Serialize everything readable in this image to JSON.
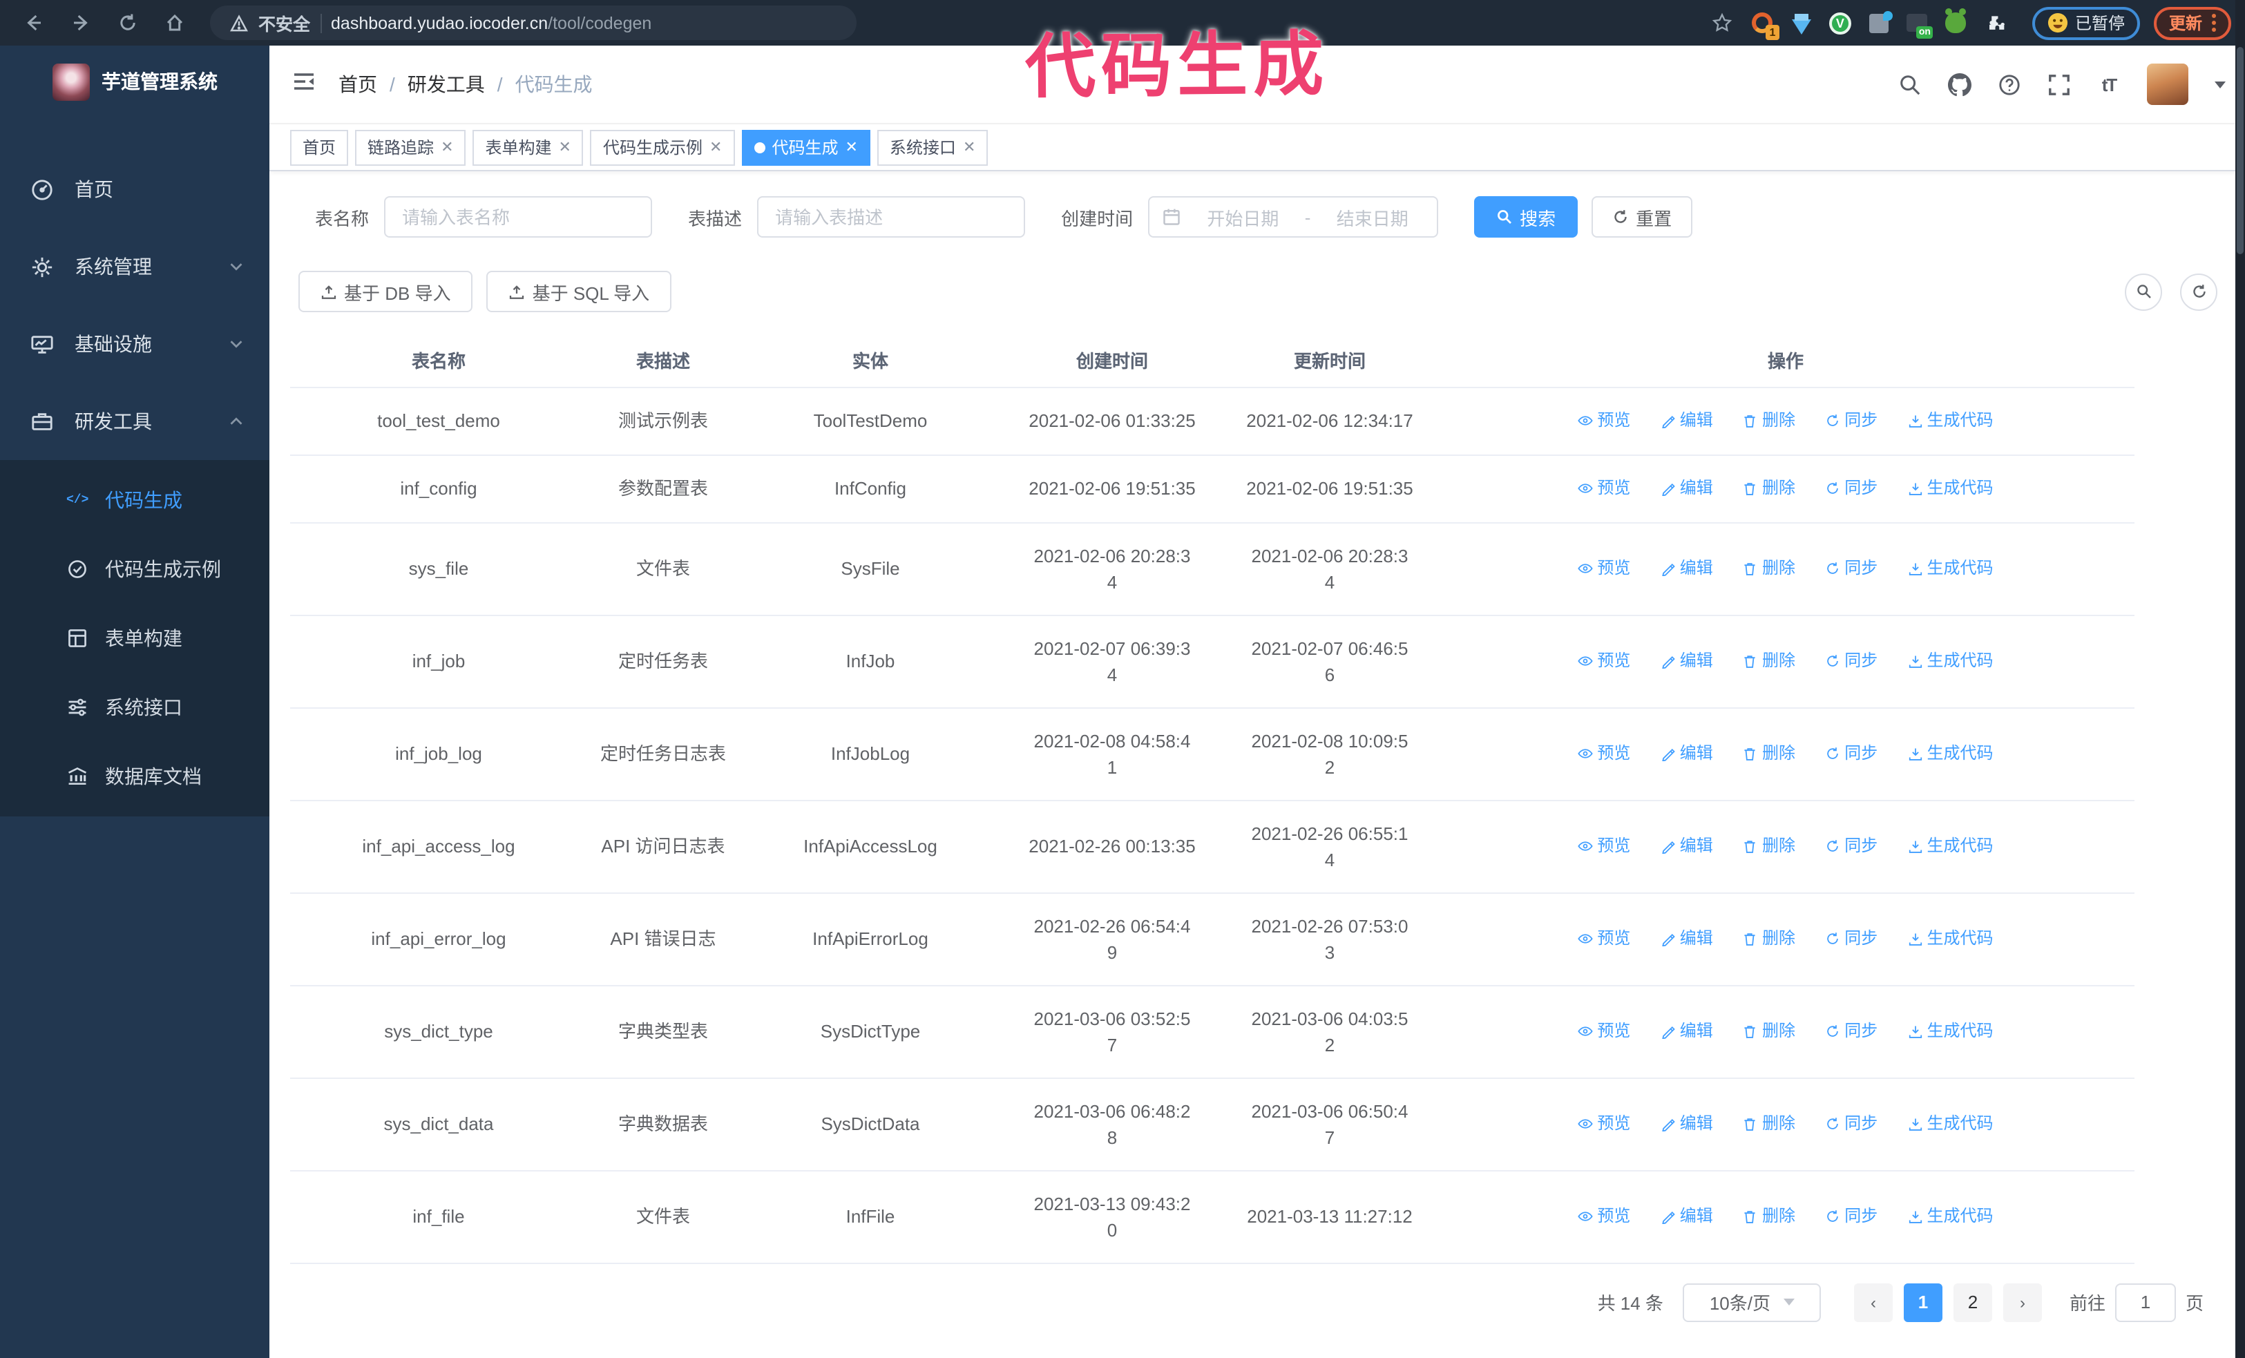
{
  "colors": {
    "accent": "#409eff",
    "annotation": "#ee4070",
    "browser_bar_bg": "#202b38",
    "sidebar_bg": "#223750",
    "sidebar_submenu_bg": "#1b2b3c",
    "paused_border": "#3f8cd6",
    "update_accent": "#e25b3c"
  },
  "annotation": {
    "text": "代码生成"
  },
  "browser": {
    "security_label": "不安全",
    "url_host": "dashboard.yudao.iocoder.cn",
    "url_path": "/tool/codegen",
    "extension_badge": "1",
    "extension_on_badge": "on",
    "paused_badge": "已暂停",
    "update_button": "更新"
  },
  "sidebar": {
    "title": "芋道管理系统",
    "items": [
      {
        "label": "首页"
      },
      {
        "label": "系统管理"
      },
      {
        "label": "基础设施"
      },
      {
        "label": "研发工具"
      }
    ],
    "submenu": [
      {
        "label": "代码生成"
      },
      {
        "label": "代码生成示例"
      },
      {
        "label": "表单构建"
      },
      {
        "label": "系统接口"
      },
      {
        "label": "数据库文档"
      }
    ]
  },
  "navbar": {
    "breadcrumb": [
      "首页",
      "研发工具",
      "代码生成"
    ],
    "separator": "/"
  },
  "tabs": [
    {
      "label": "首页"
    },
    {
      "label": "链路追踪"
    },
    {
      "label": "表单构建"
    },
    {
      "label": "代码生成示例"
    },
    {
      "label": "代码生成"
    },
    {
      "label": "系统接口"
    }
  ],
  "filter": {
    "table_name_label": "表名称",
    "table_name_placeholder": "请输入表名称",
    "table_desc_label": "表描述",
    "table_desc_placeholder": "请输入表描述",
    "create_time_label": "创建时间",
    "date_start_placeholder": "开始日期",
    "date_separator": "-",
    "date_end_placeholder": "结束日期",
    "search_label": "搜索",
    "reset_label": "重置"
  },
  "toolbar": {
    "db_import_label": "基于 DB 导入",
    "sql_import_label": "基于 SQL 导入"
  },
  "table": {
    "columns": [
      "表名称",
      "表描述",
      "实体",
      "创建时间",
      "更新时间",
      "操作"
    ],
    "actions": [
      "预览",
      "编辑",
      "删除",
      "同步",
      "生成代码"
    ],
    "rows": [
      {
        "name": "tool_test_demo",
        "desc": "测试示例表",
        "entity": "ToolTestDemo",
        "created": "2021-02-06 01:33:25",
        "updated": "2021-02-06 12:34:17"
      },
      {
        "name": "inf_config",
        "desc": "参数配置表",
        "entity": "InfConfig",
        "created": "2021-02-06 19:51:35",
        "updated": "2021-02-06 19:51:35"
      },
      {
        "name": "sys_file",
        "desc": "文件表",
        "entity": "SysFile",
        "created": "2021-02-06 20:28:3\n4",
        "updated": "2021-02-06 20:28:3\n4"
      },
      {
        "name": "inf_job",
        "desc": "定时任务表",
        "entity": "InfJob",
        "created": "2021-02-07 06:39:3\n4",
        "updated": "2021-02-07 06:46:5\n6"
      },
      {
        "name": "inf_job_log",
        "desc": "定时任务日志表",
        "entity": "InfJobLog",
        "created": "2021-02-08 04:58:4\n1",
        "updated": "2021-02-08 10:09:5\n2"
      },
      {
        "name": "inf_api_access_log",
        "desc": "API 访问日志表",
        "entity": "InfApiAccessLog",
        "created": "2021-02-26 00:13:35",
        "updated": "2021-02-26 06:55:1\n4"
      },
      {
        "name": "inf_api_error_log",
        "desc": "API 错误日志",
        "entity": "InfApiErrorLog",
        "created": "2021-02-26 06:54:4\n9",
        "updated": "2021-02-26 07:53:0\n3"
      },
      {
        "name": "sys_dict_type",
        "desc": "字典类型表",
        "entity": "SysDictType",
        "created": "2021-03-06 03:52:5\n7",
        "updated": "2021-03-06 04:03:5\n2"
      },
      {
        "name": "sys_dict_data",
        "desc": "字典数据表",
        "entity": "SysDictData",
        "created": "2021-03-06 06:48:2\n8",
        "updated": "2021-03-06 06:50:4\n7"
      },
      {
        "name": "inf_file",
        "desc": "文件表",
        "entity": "InfFile",
        "created": "2021-03-13 09:43:2\n0",
        "updated": "2021-03-13 11:27:12"
      }
    ]
  },
  "pagination": {
    "total_text": "共 14 条",
    "page_size": "10条/页",
    "pages": [
      "1",
      "2"
    ],
    "active_page": "1",
    "goto_label": "前往",
    "goto_value": "1",
    "goto_suffix": "页"
  }
}
